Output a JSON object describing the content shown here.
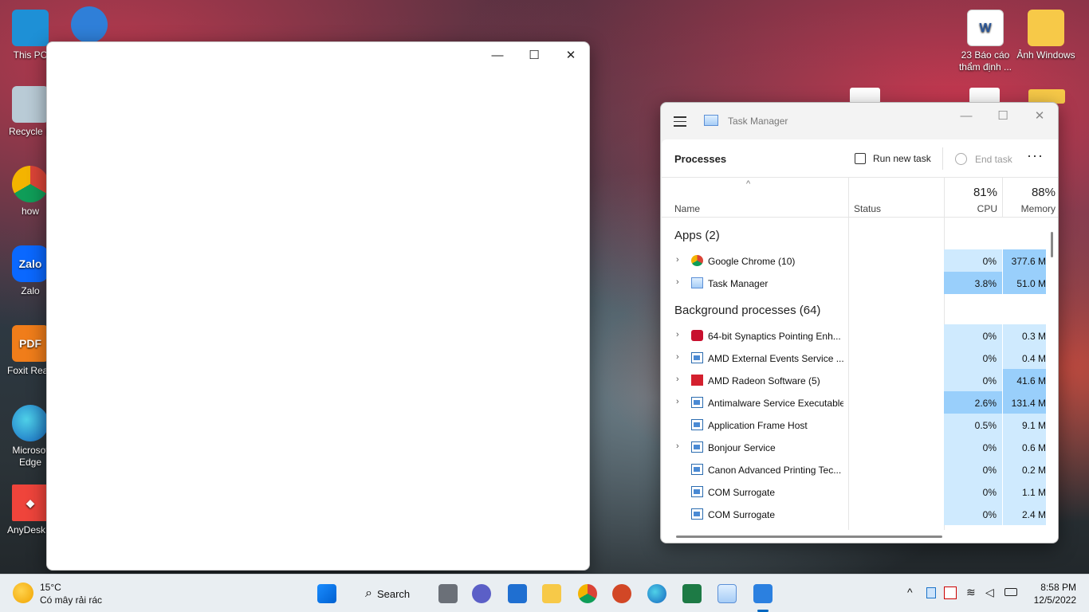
{
  "desktop": {
    "left_icons": [
      "This PC",
      "Recycle B",
      "how",
      "Zalo",
      "Foxit Read",
      "Microsof Edge",
      "AnyDesk.e"
    ],
    "right_icons": [
      "23 Báo cáo thẩm định ...",
      "Ảnh Windows"
    ],
    "zalo_glyph": "Zalo",
    "foxit_glyph": "PDF"
  },
  "blank_window": {
    "minimize": "—",
    "maximize": "☐",
    "close": "✕"
  },
  "task_manager": {
    "title": "Task Manager",
    "section": "Processes",
    "run_new_task": "Run new task",
    "end_task": "End task",
    "more": "···",
    "columns": {
      "name": "Name",
      "status": "Status",
      "cpu_pct": "81%",
      "cpu": "CPU",
      "mem_pct": "88%",
      "memory": "Memory"
    },
    "apps_group": "Apps (2)",
    "bg_group": "Background processes (64)",
    "apps": [
      {
        "name": "Google Chrome (10)",
        "cpu": "0%",
        "mem": "377.6 M"
      },
      {
        "name": "Task Manager",
        "cpu": "3.8%",
        "mem": "51.0 M"
      }
    ],
    "background": [
      {
        "name": "64-bit Synaptics Pointing Enh...",
        "cpu": "0%",
        "mem": "0.3 M"
      },
      {
        "name": "AMD External Events Service ...",
        "cpu": "0%",
        "mem": "0.4 M"
      },
      {
        "name": "AMD Radeon Software (5)",
        "cpu": "0%",
        "mem": "41.6 M"
      },
      {
        "name": "Antimalware Service Executable",
        "cpu": "2.6%",
        "mem": "131.4 M"
      },
      {
        "name": "Application Frame Host",
        "cpu": "0.5%",
        "mem": "9.1 M"
      },
      {
        "name": "Bonjour Service",
        "cpu": "0%",
        "mem": "0.6 M"
      },
      {
        "name": "Canon Advanced Printing Tec...",
        "cpu": "0%",
        "mem": "0.2 M"
      },
      {
        "name": "COM Surrogate",
        "cpu": "0%",
        "mem": "1.1 M"
      },
      {
        "name": "COM Surrogate",
        "cpu": "0%",
        "mem": "2.4 M"
      }
    ]
  },
  "taskbar": {
    "weather_temp": "15°C",
    "weather_desc": "Có mây rải rác",
    "search": "Search",
    "time": "8:58 PM",
    "date": "12/5/2022"
  }
}
